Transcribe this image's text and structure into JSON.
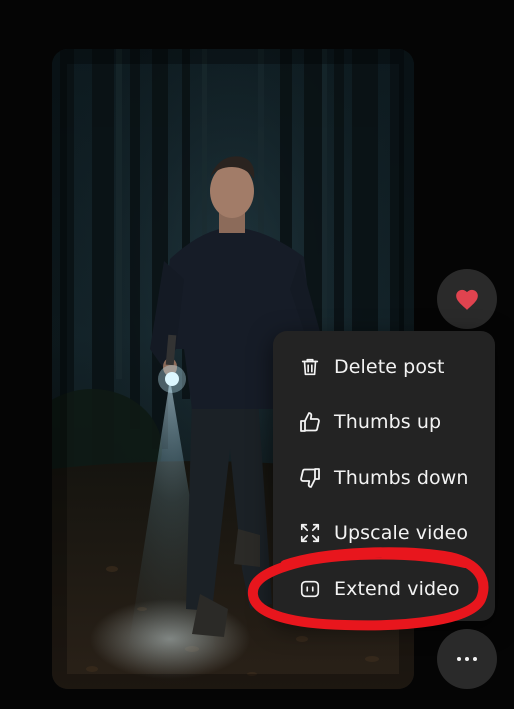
{
  "post": {
    "media_description": "video-frame",
    "liked": true
  },
  "actions": {
    "like_icon": "heart-icon",
    "more_icon": "more-horizontal-icon"
  },
  "menu": {
    "items": [
      {
        "label": "Delete post",
        "icon": "trash-icon"
      },
      {
        "label": "Thumbs up",
        "icon": "thumbs-up-icon"
      },
      {
        "label": "Thumbs down",
        "icon": "thumbs-down-icon"
      },
      {
        "label": "Upscale video",
        "icon": "expand-icon"
      },
      {
        "label": "Extend video",
        "icon": "extend-icon"
      }
    ]
  },
  "colors": {
    "background": "#050505",
    "menu_bg": "#232323",
    "button_bg": "#2a2a2a",
    "heart": "#e0434f",
    "annotation": "#e8161d",
    "text": "#f3f3f3"
  }
}
